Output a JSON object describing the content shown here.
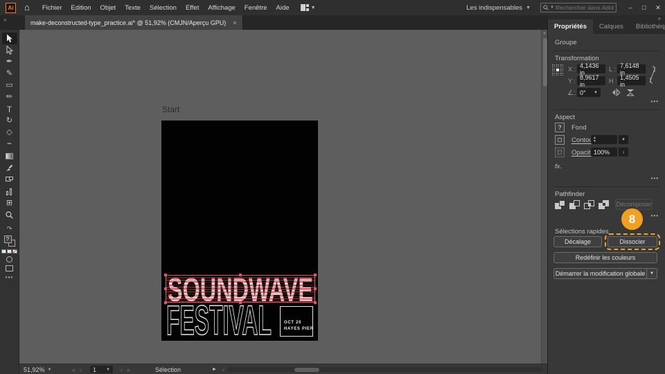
{
  "titlebar": {
    "logo": "Ai",
    "menus": [
      "Fichier",
      "Edition",
      "Objet",
      "Texte",
      "Sélection",
      "Effet",
      "Affichage",
      "Fenêtre",
      "Aide"
    ],
    "workspace": "Les indispensables",
    "search_placeholder": "Rechercher dans Adobe Stock",
    "window": {
      "minimize": "–",
      "maximize": "□",
      "close": "✕"
    }
  },
  "tab": {
    "title": "make-deconstructed-type_practice.ai* @ 51,92% (CMJN/Aperçu GPU)",
    "close": "×"
  },
  "canvas": {
    "artboard_name": "Start",
    "poster": {
      "title": "SOUNDWAVE",
      "subtitle": "FESTIVAL",
      "date": "OCT 20",
      "venue": "HAYES PIER"
    }
  },
  "panel": {
    "expand_icon": "»",
    "tabs": [
      "Propriétés",
      "Calques",
      "Bibliothèques"
    ],
    "selection_type": "Groupe",
    "more": "•••",
    "transform": {
      "heading": "Transformation",
      "x_label": "X :",
      "x": "4,1436 in",
      "y_label": "Y :",
      "y": "8,9617 in",
      "w_label": "L :",
      "w": "7,6148 in",
      "h_label": "H :",
      "h": "1,4505 in",
      "angle": "0°"
    },
    "aspect": {
      "heading": "Aspect",
      "fill": "Fond",
      "fill_swatch": "?",
      "stroke": "Contour",
      "opacity": "Opacité",
      "opacity_value": "100%",
      "fx": "fx."
    },
    "pathfinder": {
      "heading": "Pathfinder",
      "expand": "Décomposer"
    },
    "quick": {
      "heading": "Sélections rapides",
      "offset": "Décalage",
      "ungroup": "Dissocier",
      "recolor": "Redéfinir les couleurs",
      "global": "Démarrer la modification globale"
    },
    "badge": "8"
  },
  "statusbar": {
    "zoom": "51,92%",
    "artboard": "1",
    "status": "Sélection"
  },
  "colors": {
    "accent_orange": "#F0A124",
    "stripe_red": "#D5495A",
    "selection_red": "#EF4D5F",
    "pasteboard_gray": "#5E5E5E",
    "artboard_black": "#020202"
  }
}
